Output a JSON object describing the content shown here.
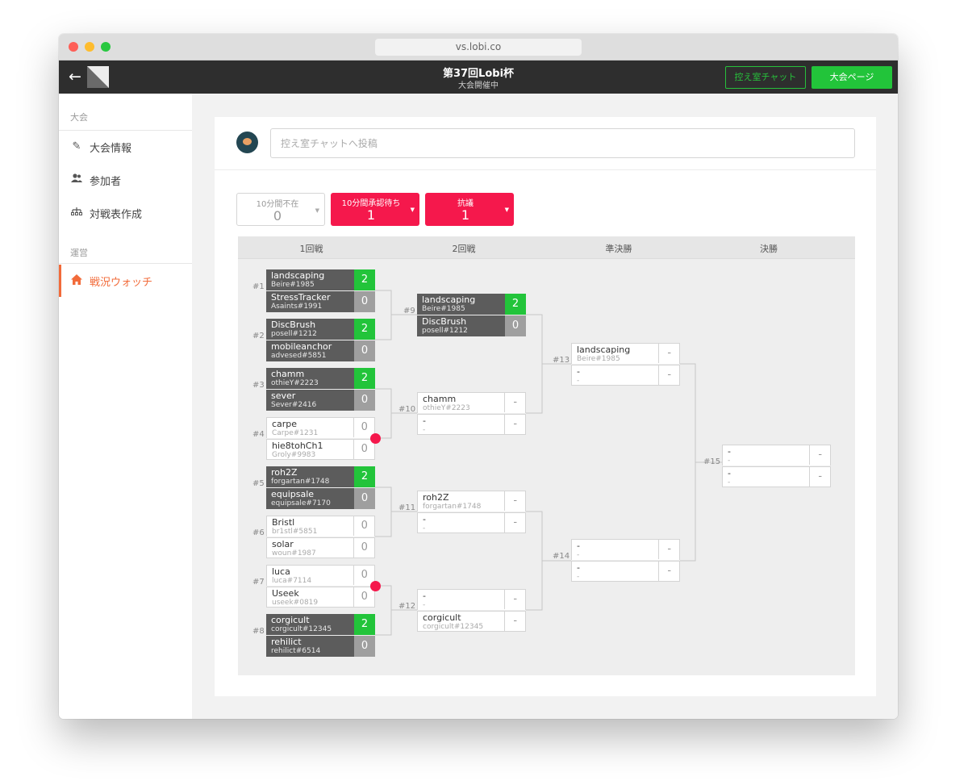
{
  "browser": {
    "url": "vs.lobi.co"
  },
  "header": {
    "title": "第37回Lobi杯",
    "subtitle": "大会開催中",
    "chat_button": "控え室チャット",
    "page_button": "大会ページ"
  },
  "sidebar": {
    "section1": "大会",
    "items": [
      {
        "label": "大会情報",
        "icon": "pencil-icon"
      },
      {
        "label": "参加者",
        "icon": "users-icon"
      },
      {
        "label": "対戦表作成",
        "icon": "bracket-icon"
      }
    ],
    "section2": "運営",
    "active_item": {
      "label": "戦況ウォッチ",
      "icon": "home-icon"
    }
  },
  "chat": {
    "placeholder": "控え室チャットへ投稿"
  },
  "stats": [
    {
      "label": "10分間不在",
      "value": "0"
    },
    {
      "label": "10分間承認待ち",
      "value": "1"
    },
    {
      "label": "抗議",
      "value": "1"
    }
  ],
  "rounds": [
    "1回戦",
    "2回戦",
    "準決勝",
    "決勝"
  ],
  "matches": {
    "m1": {
      "label": "#1",
      "a": {
        "name": "landscaping",
        "id": "Beire#1985",
        "score": "2"
      },
      "b": {
        "name": "StressTracker",
        "id": "Asaints#1991",
        "score": "0"
      }
    },
    "m2": {
      "label": "#2",
      "a": {
        "name": "DiscBrush",
        "id": "posell#1212",
        "score": "2"
      },
      "b": {
        "name": "mobileanchor",
        "id": "advesed#5851",
        "score": "0"
      }
    },
    "m3": {
      "label": "#3",
      "a": {
        "name": "chamm",
        "id": "othieY#2223",
        "score": "2"
      },
      "b": {
        "name": "sever",
        "id": "Sever#2416",
        "score": "0"
      }
    },
    "m4": {
      "label": "#4",
      "a": {
        "name": "carpe",
        "id": "Carpe#1231",
        "score": "0"
      },
      "b": {
        "name": "hie8tohCh1",
        "id": "Groly#9983",
        "score": "0"
      }
    },
    "m5": {
      "label": "#5",
      "a": {
        "name": "roh2Z",
        "id": "forgartan#1748",
        "score": "2"
      },
      "b": {
        "name": "equipsale",
        "id": "equipsale#7170",
        "score": "0"
      }
    },
    "m6": {
      "label": "#6",
      "a": {
        "name": "Bristl",
        "id": "br1stl#5851",
        "score": "0"
      },
      "b": {
        "name": "solar",
        "id": "woun#1987",
        "score": "0"
      }
    },
    "m7": {
      "label": "#7",
      "a": {
        "name": "luca",
        "id": "luca#7114",
        "score": "0"
      },
      "b": {
        "name": "Useek",
        "id": "useek#0819",
        "score": "0"
      }
    },
    "m8": {
      "label": "#8",
      "a": {
        "name": "corgicult",
        "id": "corgicult#12345",
        "score": "2"
      },
      "b": {
        "name": "rehilict",
        "id": "rehilict#6514",
        "score": "0"
      }
    },
    "m9": {
      "label": "#9",
      "a": {
        "name": "landscaping",
        "id": "Beire#1985",
        "score": "2"
      },
      "b": {
        "name": "DiscBrush",
        "id": "posell#1212",
        "score": "0"
      }
    },
    "m10": {
      "label": "#10",
      "a": {
        "name": "chamm",
        "id": "othieY#2223",
        "score": "-"
      },
      "b": {
        "name": "-",
        "id": "-",
        "score": "-"
      }
    },
    "m11": {
      "label": "#11",
      "a": {
        "name": "roh2Z",
        "id": "forgartan#1748",
        "score": "-"
      },
      "b": {
        "name": "-",
        "id": "-",
        "score": "-"
      }
    },
    "m12": {
      "label": "#12",
      "a": {
        "name": "-",
        "id": "-",
        "score": "-"
      },
      "b": {
        "name": "corgicult",
        "id": "corgicult#12345",
        "score": "-"
      }
    },
    "m13": {
      "label": "#13",
      "a": {
        "name": "landscaping",
        "id": "Beire#1985",
        "score": "-"
      },
      "b": {
        "name": "-",
        "id": "-",
        "score": "-"
      }
    },
    "m14": {
      "label": "#14",
      "a": {
        "name": "-",
        "id": "-",
        "score": "-"
      },
      "b": {
        "name": "-",
        "id": "-",
        "score": "-"
      }
    },
    "m15": {
      "label": "#15",
      "a": {
        "name": "-",
        "id": "-",
        "score": "-"
      },
      "b": {
        "name": "-",
        "id": "-",
        "score": "-"
      }
    }
  }
}
